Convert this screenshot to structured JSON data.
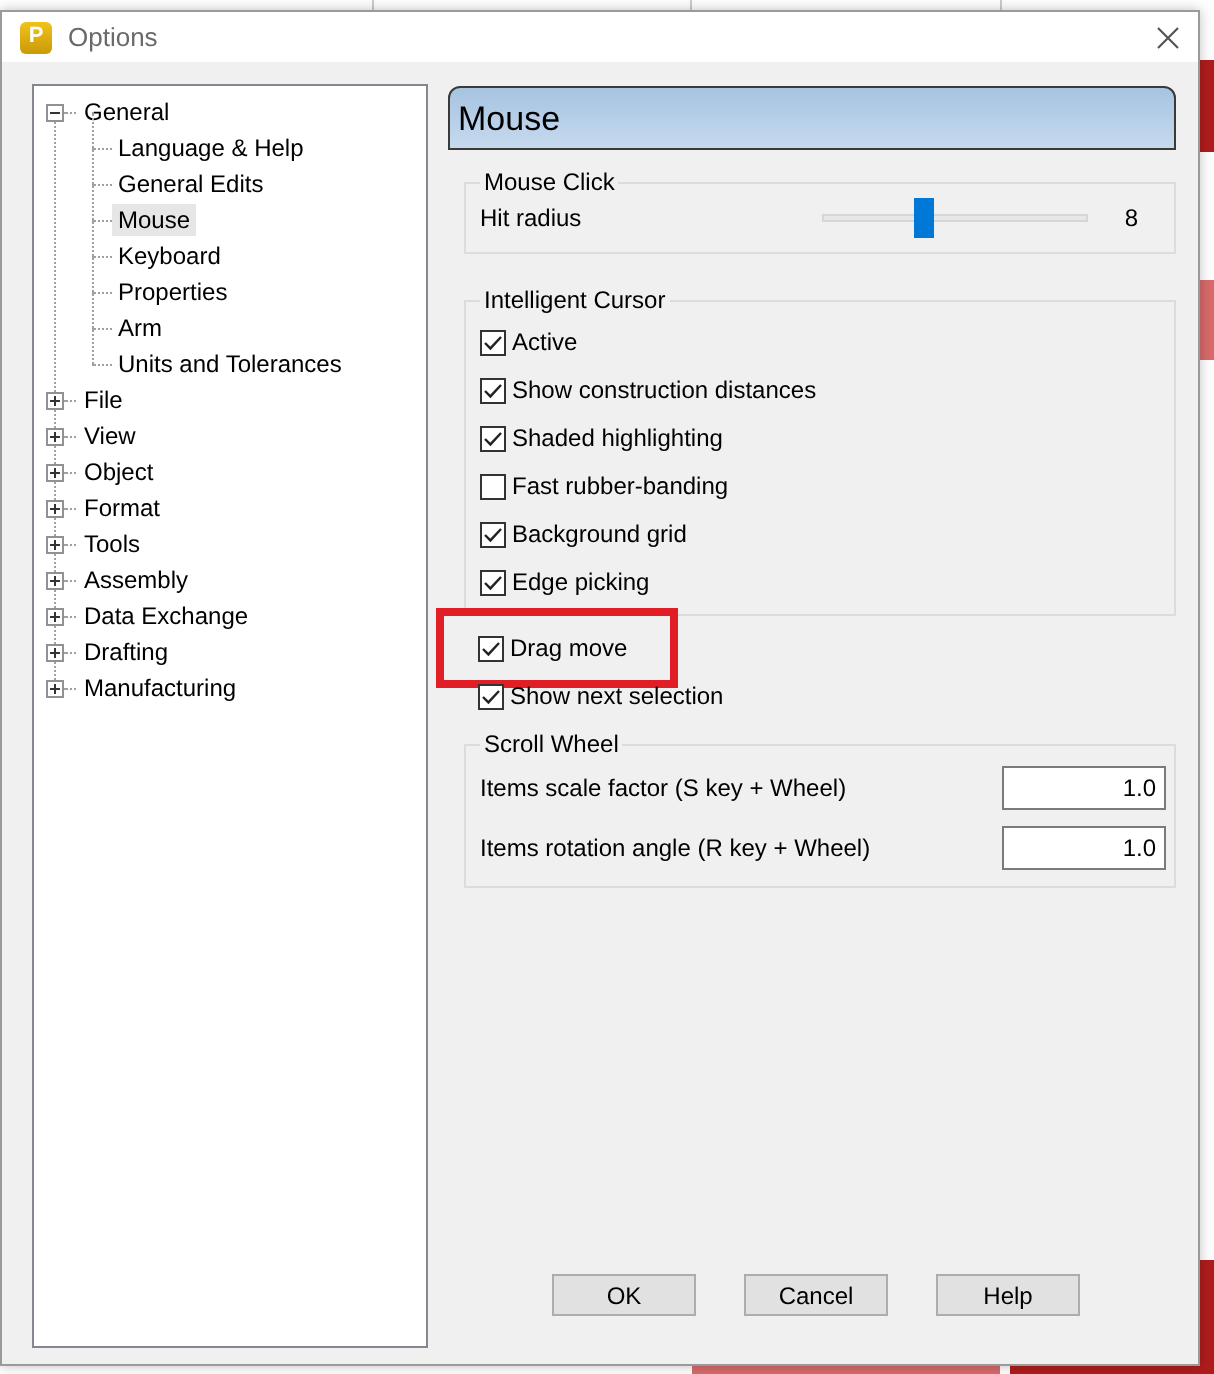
{
  "window": {
    "title": "Options",
    "logo_letter": "P"
  },
  "tree": [
    {
      "label": "General",
      "expanded": true,
      "selected": false,
      "children": [
        {
          "label": "Language & Help",
          "selected": false
        },
        {
          "label": "General Edits",
          "selected": false
        },
        {
          "label": "Mouse",
          "selected": true
        },
        {
          "label": "Keyboard",
          "selected": false
        },
        {
          "label": "Properties",
          "selected": false
        },
        {
          "label": "Arm",
          "selected": false
        },
        {
          "label": "Units and Tolerances",
          "selected": false
        }
      ]
    },
    {
      "label": "File",
      "expanded": false,
      "selected": false
    },
    {
      "label": "View",
      "expanded": false,
      "selected": false
    },
    {
      "label": "Object",
      "expanded": false,
      "selected": false
    },
    {
      "label": "Format",
      "expanded": false,
      "selected": false
    },
    {
      "label": "Tools",
      "expanded": false,
      "selected": false
    },
    {
      "label": "Assembly",
      "expanded": false,
      "selected": false
    },
    {
      "label": "Data Exchange",
      "expanded": false,
      "selected": false
    },
    {
      "label": "Drafting",
      "expanded": false,
      "selected": false
    },
    {
      "label": "Manufacturing",
      "expanded": false,
      "selected": false
    }
  ],
  "page_title": "Mouse",
  "mouse_click": {
    "title": "Mouse Click",
    "slider": {
      "label": "Hit radius",
      "level": 0.37,
      "reading": "8"
    }
  },
  "intelligent_cursor": {
    "title": "Intelligent Cursor",
    "options": [
      {
        "label": "Active",
        "checked": true
      },
      {
        "label": "Show construction distances",
        "checked": true
      },
      {
        "label": "Shaded highlighting",
        "checked": true
      },
      {
        "label": "Fast rubber-banding",
        "checked": false
      },
      {
        "label": "Background grid",
        "checked": true
      },
      {
        "label": "Edge picking",
        "checked": true
      }
    ]
  },
  "options": [
    {
      "label": "Drag move",
      "checked": true,
      "highlighted": true
    },
    {
      "label": "Show next selection",
      "checked": true,
      "highlighted": false
    }
  ],
  "scroll_wheel": {
    "title": "Scroll Wheel",
    "fields": [
      {
        "label": "Items scale factor (S key + Wheel)",
        "value": "1.0"
      },
      {
        "label": "Items rotation angle (R key + Wheel)",
        "value": "1.0"
      }
    ]
  },
  "buttons": [
    "OK",
    "Cancel",
    "Help"
  ]
}
